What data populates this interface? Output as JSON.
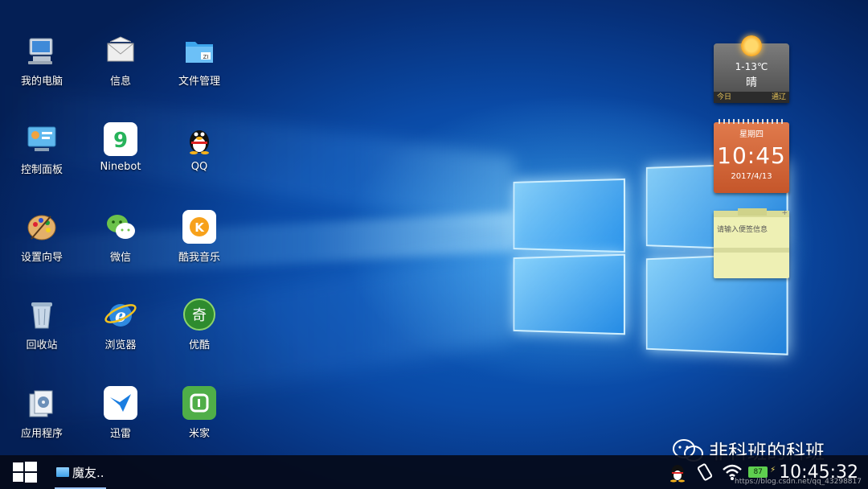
{
  "desktop": {
    "icons": [
      {
        "label": "我的电脑",
        "icon": "computer-icon"
      },
      {
        "label": "信息",
        "icon": "mail-icon"
      },
      {
        "label": "文件管理",
        "icon": "folder-icon"
      },
      {
        "label": "控制面板",
        "icon": "control-panel-icon"
      },
      {
        "label": "Ninebot",
        "icon": "ninebot-icon"
      },
      {
        "label": "QQ",
        "icon": "qq-penguin-icon"
      },
      {
        "label": "设置向导",
        "icon": "palette-icon"
      },
      {
        "label": "微信",
        "icon": "wechat-icon"
      },
      {
        "label": "酷我音乐",
        "icon": "kuwo-music-icon"
      },
      {
        "label": "回收站",
        "icon": "recycle-bin-icon"
      },
      {
        "label": "浏览器",
        "icon": "browser-icon"
      },
      {
        "label": "优酷",
        "icon": "youku-icon"
      },
      {
        "label": "应用程序",
        "icon": "applications-icon"
      },
      {
        "label": "迅雷",
        "icon": "xunlei-icon"
      },
      {
        "label": "米家",
        "icon": "mijia-icon"
      }
    ]
  },
  "widgets": {
    "weather": {
      "temp": "1-13℃",
      "condition": "晴",
      "today": "今日",
      "link": "通辽",
      "icon": "sun-icon"
    },
    "clock": {
      "weekday": "星期四",
      "time": "10:45",
      "date": "2017/4/13"
    },
    "note": {
      "placeholder": "请输入便签信息"
    }
  },
  "taskbar": {
    "start": "windows-start-icon",
    "item": "魔友..",
    "battery": "87",
    "time": "10:45:32"
  },
  "watermark": {
    "brand": "非科班的科班",
    "url": "https://blog.csdn.net/qq_43298817"
  },
  "colors": {
    "desktop_bg": "#0a4aa6",
    "clock_widget": "#d9653a",
    "note_widget": "#eef0b4",
    "taskbar": "#050a19"
  }
}
